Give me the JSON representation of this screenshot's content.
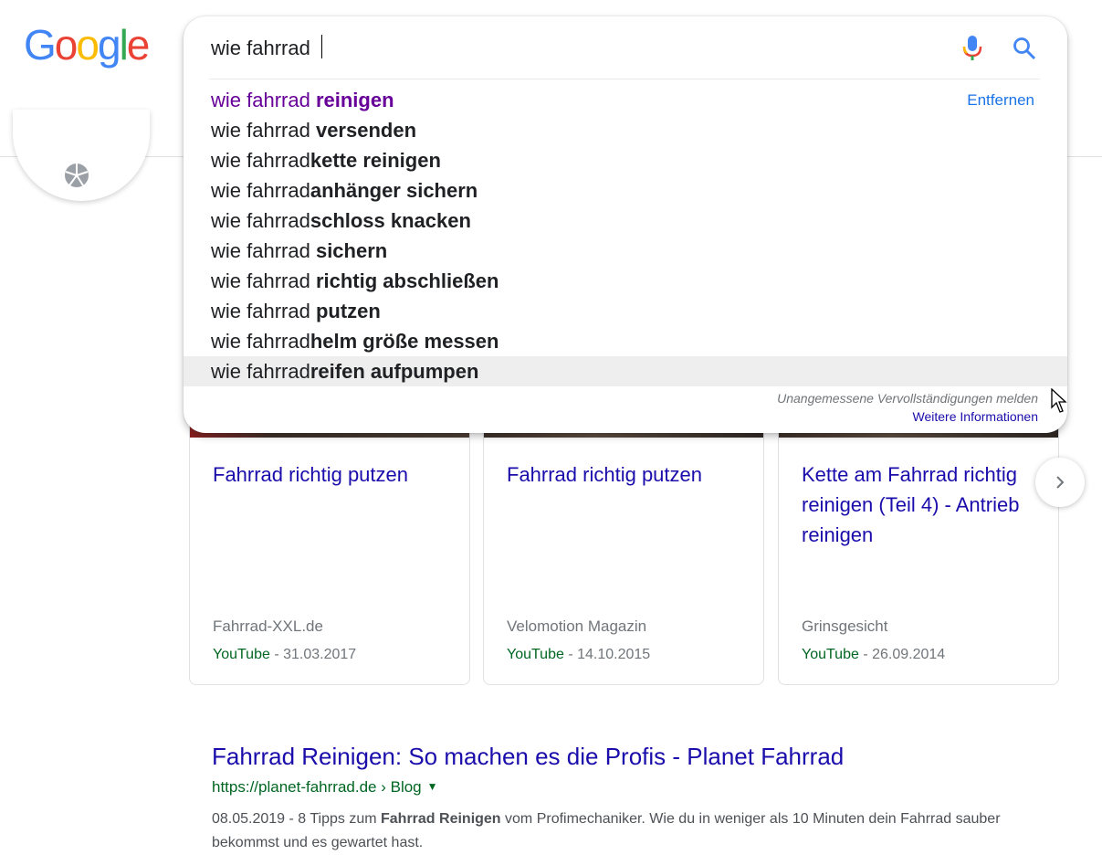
{
  "logo": {
    "letters": [
      {
        "char": "G",
        "color": "#4285F4"
      },
      {
        "char": "o",
        "color": "#EA4335"
      },
      {
        "char": "o",
        "color": "#FBBC05"
      },
      {
        "char": "g",
        "color": "#4285F4"
      },
      {
        "char": "l",
        "color": "#34A853"
      },
      {
        "char": "e",
        "color": "#EA4335"
      }
    ]
  },
  "search": {
    "query": "wie fahrrad",
    "mic_icon": "microphone-icon",
    "search_icon": "search-icon",
    "remove_label": "Entfernen",
    "suggestions": [
      {
        "prefix": "wie fahrrad ",
        "bold": "reinigen",
        "visited": true
      },
      {
        "prefix": "wie fahrrad ",
        "bold": "versenden"
      },
      {
        "prefix": "wie fahrrad",
        "bold": "kette reinigen"
      },
      {
        "prefix": "wie fahrrad",
        "bold": "anhänger sichern"
      },
      {
        "prefix": "wie fahrrad",
        "bold": "schloss knacken"
      },
      {
        "prefix": "wie fahrrad ",
        "bold": "sichern"
      },
      {
        "prefix": "wie fahrrad ",
        "bold": "richtig abschließen"
      },
      {
        "prefix": "wie fahrrad ",
        "bold": "putzen"
      },
      {
        "prefix": "wie fahrrad",
        "bold": "helm größe messen"
      },
      {
        "prefix": "wie fahrrad",
        "bold": "reifen aufpumpen",
        "hovered": true
      }
    ],
    "report_label": "Unangemessene Vervollständigungen melden",
    "more_info_label": "Weitere Informationen"
  },
  "videos": [
    {
      "title": "Fahrrad richtig putzen",
      "source": "Fahrrad-XXL.de",
      "platform": "YouTube",
      "date": " - 31.03.2017"
    },
    {
      "title": "Fahrrad richtig putzen",
      "source": "Velomotion Magazin",
      "platform": "YouTube",
      "date": " - 14.10.2015"
    },
    {
      "title": "Kette am Fahrrad richtig reinigen (Teil 4) - Antrieb reinigen",
      "source": "Grinsgesicht",
      "platform": "YouTube",
      "date": " - 26.09.2014"
    }
  ],
  "result": {
    "title": "Fahrrad Reinigen: So machen es die Profis - Planet Fahrrad",
    "url": "https://planet-fahrrad.de › Blog",
    "snippet_date": "08.05.2019 - 8 Tipps zum ",
    "snippet_bold": "Fahrrad Reinigen",
    "snippet_rest": " vom Profimechaniker. Wie du in weniger als 10 Minuten dein Fahrrad sauber bekommst und es gewartet hast."
  }
}
